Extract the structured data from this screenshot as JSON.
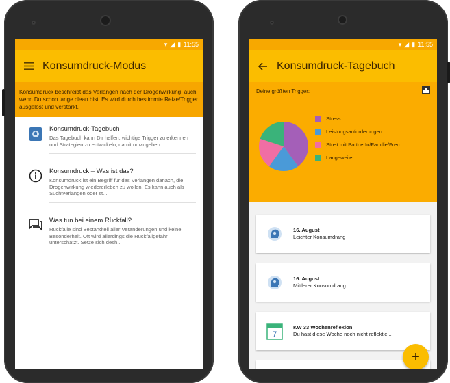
{
  "status": {
    "time": "11:55"
  },
  "left": {
    "title": "Konsumdruck-Modus",
    "nav_icon": "menu-icon",
    "banner": "Konsumdruck beschreibt das Verlangen nach der Drogenwirkung, auch wenn Du schon lange clean bist. Es wird durch bestimmte Reize/Trigger ausgelöst und verstärkt.",
    "items": [
      {
        "icon": "diary-icon",
        "title": "Konsumdruck-Tagebuch",
        "desc": "Das Tagebuch kann Dir helfen, wichtige Trigger zu erkennen und Strategien zu entwickeln, damit umzugehen."
      },
      {
        "icon": "info-icon",
        "title": "Konsumdruck – Was ist das?",
        "desc": "Konsumdruck ist ein Begriff für das Verlangen danach, die Drogenwirkung wiedererleben zu wollen. Es kann auch als Suchtverlangen oder st..."
      },
      {
        "icon": "chat-icon",
        "title": "Was tun bei einem Rückfall?",
        "desc": "Rückfälle sind Bestandteil aller Veränderungen und keine Besonderheit. Oft wird allerdings die Rückfallgefahr unterschätzt. Setze sich desh..."
      }
    ]
  },
  "right": {
    "title": "Konsumdruck-Tagebuch",
    "nav_icon": "back-arrow-icon",
    "trigger_heading": "Deine größten Trigger:",
    "chart_icon": "bar-chart-icon",
    "chart_data": {
      "type": "pie",
      "categories": [
        "Stress",
        "Leistungsanforderungen",
        "Streit mit PartnerIn/Familie/Freu...",
        "Langeweile"
      ],
      "values": [
        40,
        20,
        20,
        20
      ],
      "colors": [
        "#a45fb8",
        "#4a9ad8",
        "#f06ea4",
        "#3ab37a"
      ],
      "legend": "right"
    },
    "entries": [
      {
        "icon": "head-icon",
        "date": "16. August",
        "text": "Leichter Konsumdrang"
      },
      {
        "icon": "head-icon",
        "date": "16. August",
        "text": "Mittlerer Konsumdrang"
      },
      {
        "icon": "calendar-icon",
        "date": "KW 33 Wochenreflexion",
        "text": "Du hast diese Woche noch nicht reflektie...",
        "calendar_day": "7"
      }
    ],
    "fab": "+"
  }
}
